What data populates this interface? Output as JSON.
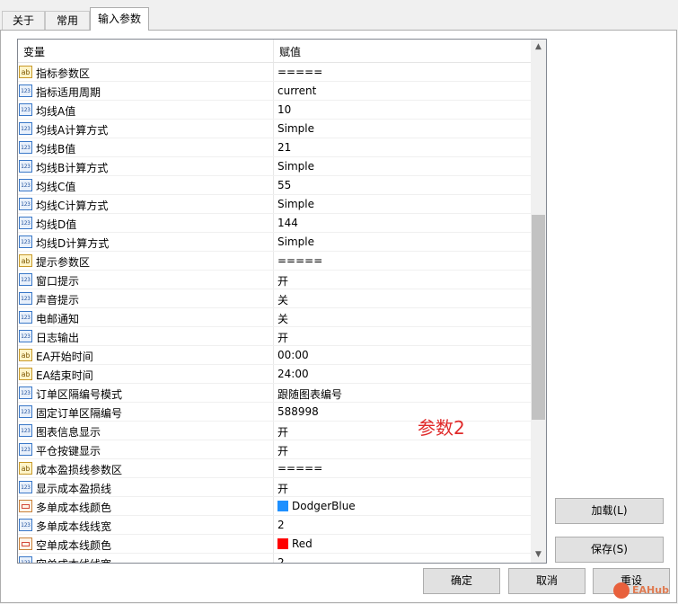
{
  "tabs": [
    {
      "label": "关于"
    },
    {
      "label": "常用"
    },
    {
      "label": "输入参数"
    }
  ],
  "grid": {
    "col_variable": "变量",
    "col_value": "赋值",
    "rows": [
      {
        "icon": "ab",
        "name": "指标参数区",
        "value": "====="
      },
      {
        "icon": "123",
        "name": "指标适用周期",
        "value": "current"
      },
      {
        "icon": "123",
        "name": "均线A值",
        "value": "10"
      },
      {
        "icon": "123",
        "name": "均线A计算方式",
        "value": "Simple"
      },
      {
        "icon": "123",
        "name": "均线B值",
        "value": "21"
      },
      {
        "icon": "123",
        "name": "均线B计算方式",
        "value": "Simple"
      },
      {
        "icon": "123",
        "name": "均线C值",
        "value": "55"
      },
      {
        "icon": "123",
        "name": "均线C计算方式",
        "value": "Simple"
      },
      {
        "icon": "123",
        "name": "均线D值",
        "value": "144"
      },
      {
        "icon": "123",
        "name": "均线D计算方式",
        "value": "Simple"
      },
      {
        "icon": "ab",
        "name": "提示参数区",
        "value": "====="
      },
      {
        "icon": "123",
        "name": "窗口提示",
        "value": "开"
      },
      {
        "icon": "123",
        "name": "声音提示",
        "value": "关"
      },
      {
        "icon": "123",
        "name": "电邮通知",
        "value": "关"
      },
      {
        "icon": "123",
        "name": "日志输出",
        "value": "开"
      },
      {
        "icon": "ab",
        "name": "EA开始时间",
        "value": "00:00"
      },
      {
        "icon": "ab",
        "name": "EA结束时间",
        "value": "24:00"
      },
      {
        "icon": "123",
        "name": "订单区隔编号模式",
        "value": "跟随图表编号"
      },
      {
        "icon": "123",
        "name": "固定订单区隔编号",
        "value": "588998"
      },
      {
        "icon": "123",
        "name": "图表信息显示",
        "value": "开"
      },
      {
        "icon": "123",
        "name": "平仓按键显示",
        "value": "开"
      },
      {
        "icon": "ab",
        "name": "成本盈损线参数区",
        "value": "====="
      },
      {
        "icon": "123",
        "name": "显示成本盈损线",
        "value": "开"
      },
      {
        "icon": "clr",
        "name": "多单成本线颜色",
        "value": "DodgerBlue",
        "swatch": "#1e90ff"
      },
      {
        "icon": "123",
        "name": "多单成本线线宽",
        "value": "2"
      },
      {
        "icon": "clr",
        "name": "空单成本线颜色",
        "value": "Red",
        "swatch": "#ff0000"
      },
      {
        "icon": "123",
        "name": "空单成本线线宽",
        "value": "2"
      }
    ]
  },
  "icons": {
    "scroll_up": "chevron-up-icon",
    "scroll_down": "chevron-down-icon"
  },
  "overlay_text": "参数2",
  "buttons": {
    "load": "加载(L)",
    "save": "保存(S)",
    "ok": "确定",
    "cancel": "取消",
    "reset": "重设"
  },
  "logo_text": "EAHub"
}
